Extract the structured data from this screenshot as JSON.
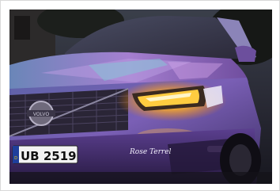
{
  "photo": {
    "subject": "car-front-at-dusk",
    "license_plate": "UB 2519",
    "plate_prefix": "D",
    "badge_text": "VOLVO",
    "signature_text": "Rose Terrel",
    "colors": {
      "body_violet": "#7d5fb8",
      "headlight_amber": "#ffb020",
      "sky_dark": "#2b2b3a"
    }
  }
}
